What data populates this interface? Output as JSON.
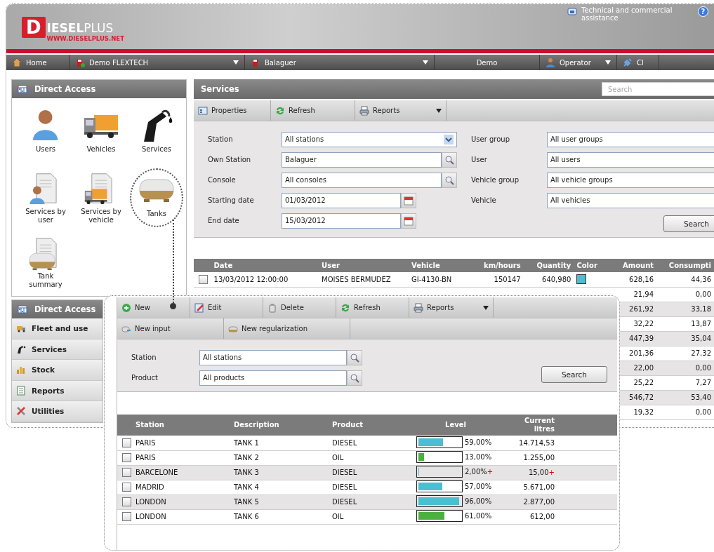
{
  "header": {
    "logo": {
      "letter": "D",
      "bold": "IESEL",
      "light": "PLUS",
      "url": "WWW.DIESELPLUS.NET"
    },
    "assistance": "Technical and commercial assistance",
    "help": "?"
  },
  "nav": [
    {
      "kind": "home",
      "label": "Home",
      "dropdown": false
    },
    {
      "kind": "company",
      "label": "Demo FLEXTECH",
      "dropdown": true
    },
    {
      "kind": "station",
      "label": "Balaguer",
      "dropdown": true
    },
    {
      "kind": "plain",
      "label": "Demo",
      "dropdown": false
    },
    {
      "kind": "user",
      "label": "Operator",
      "dropdown": true
    },
    {
      "kind": "exit",
      "label": "Cl",
      "dropdown": false
    }
  ],
  "sidebar": {
    "direct_access": {
      "title": "Direct Access",
      "items": [
        {
          "kind": "users",
          "label": "Users",
          "circled": false
        },
        {
          "kind": "vehicles",
          "label": "Vehicles",
          "circled": false
        },
        {
          "kind": "services",
          "label": "Services",
          "circled": false
        },
        {
          "kind": "services_user",
          "label": "Services by user",
          "circled": false
        },
        {
          "kind": "services_vehicle",
          "label": "Services by vehicle",
          "circled": false
        },
        {
          "kind": "tanks",
          "label": "Tanks",
          "circled": true
        },
        {
          "kind": "tank_summary",
          "label": "Tank summary",
          "circled": false
        }
      ]
    },
    "menu": {
      "title": "Direct Access",
      "items": [
        {
          "kind": "fleet",
          "label": "Fleet and use"
        },
        {
          "kind": "services",
          "label": "Services"
        },
        {
          "kind": "stock",
          "label": "Stock"
        },
        {
          "kind": "reports",
          "label": "Reports"
        },
        {
          "kind": "utilities",
          "label": "Utilities"
        }
      ]
    }
  },
  "services": {
    "title": "Services",
    "search": {
      "placeholder": "Search"
    },
    "toolbar": [
      {
        "kind": "properties",
        "label": "Properties",
        "dropdown": false
      },
      {
        "kind": "refresh",
        "label": "Refresh",
        "dropdown": false
      },
      {
        "kind": "reports",
        "label": "Reports",
        "dropdown": true
      }
    ],
    "filters_left": [
      {
        "kind": "select",
        "label": "Station",
        "value": "All stations"
      },
      {
        "kind": "lookup",
        "label": "Own Station",
        "value": "Balaguer"
      },
      {
        "kind": "lookup",
        "label": "Console",
        "value": "All consoles"
      },
      {
        "kind": "date",
        "label": "Starting date",
        "value": "01/03/2012"
      },
      {
        "kind": "date",
        "label": "End date",
        "value": "15/03/2012"
      }
    ],
    "filters_right": [
      {
        "kind": "text",
        "label": "User group",
        "value": "All user groups"
      },
      {
        "kind": "text",
        "label": "User",
        "value": "All users"
      },
      {
        "kind": "text",
        "label": "Vehicle group",
        "value": "All vehicle groups"
      },
      {
        "kind": "text",
        "label": "Vehicle",
        "value": "All vehicles"
      }
    ],
    "search_button": "Search",
    "table": {
      "columns": [
        "Date",
        "User",
        "Vehicle",
        "km/hours",
        "Quantity",
        "Color",
        "Amount",
        "Consumpti"
      ],
      "rows": [
        {
          "checked": false,
          "date": "13/03/2012 12:00:00",
          "user": "MOISES BERMUDEZ",
          "vehicle": "GI-4130-BN",
          "km": "150147",
          "quantity": "640,980",
          "color": "#4bbfcf",
          "amount": "628,16",
          "consumption": "44,36"
        },
        {
          "amount": "21,94",
          "consumption": "0,00"
        },
        {
          "amount": "261,92",
          "consumption": "33,18"
        },
        {
          "amount": "32,22",
          "consumption": "13,87"
        },
        {
          "amount": "447,39",
          "consumption": "35,04"
        },
        {
          "amount": "201,36",
          "consumption": "27,32"
        },
        {
          "amount": "22,00",
          "consumption": "0,00"
        },
        {
          "amount": "25,22",
          "consumption": "7,27"
        },
        {
          "amount": "546,72",
          "consumption": "53,40"
        },
        {
          "amount": "19,32",
          "consumption": "0,00"
        }
      ]
    }
  },
  "tanks": {
    "toolbar": [
      {
        "kind": "new",
        "label": "New",
        "dropdown": false
      },
      {
        "kind": "edit",
        "label": "Edit",
        "dropdown": false
      },
      {
        "kind": "delete",
        "label": "Delete",
        "dropdown": false
      },
      {
        "kind": "refresh",
        "label": "Refresh",
        "dropdown": false
      },
      {
        "kind": "reports",
        "label": "Reports",
        "dropdown": true
      }
    ],
    "toolbar2": [
      {
        "kind": "input",
        "label": "New input"
      },
      {
        "kind": "regularization",
        "label": "New regularization"
      }
    ],
    "filters": [
      {
        "kind": "lookup",
        "label": "Station",
        "value": "All stations"
      },
      {
        "kind": "lookup",
        "label": "Product",
        "value": "All products"
      }
    ],
    "search_button": "Search",
    "table": {
      "columns": [
        "Station",
        "Description",
        "Product",
        "Level",
        "Current litres"
      ],
      "rows": [
        {
          "checked": false,
          "station": "PARIS",
          "description": "TANK 1",
          "product": "DIESEL",
          "level": 0.59,
          "color": "#4bbfcf",
          "level_text": "59,00%",
          "litres": "14.714,53"
        },
        {
          "checked": false,
          "station": "PARIS",
          "description": "TANK 2",
          "product": "OIL",
          "level": 0.13,
          "color": "#4cb040",
          "level_text": "13,00%",
          "litres": "1.255,00"
        },
        {
          "checked": false,
          "station": "BARCELONE",
          "description": "TANK 3",
          "product": "DIESEL",
          "level": 0.02,
          "color": "#4bbfcf",
          "level_text": "2,00%",
          "level_flag": "+",
          "litres": "15,00",
          "litres_flag": "+"
        },
        {
          "checked": false,
          "station": "MADRID",
          "description": "TANK 4",
          "product": "DIESEL",
          "level": 0.57,
          "color": "#4bbfcf",
          "level_text": "57,00%",
          "litres": "5.671,00"
        },
        {
          "checked": false,
          "station": "LONDON",
          "description": "TANK 5",
          "product": "DIESEL",
          "level": 0.96,
          "color": "#4bbfcf",
          "level_text": "96,00%",
          "litres": "2.877,00"
        },
        {
          "checked": false,
          "station": "LONDON",
          "description": "TANK 6",
          "product": "OIL",
          "level": 0.61,
          "color": "#4cb040",
          "level_text": "61,00%",
          "litres": "612,00"
        }
      ]
    }
  }
}
